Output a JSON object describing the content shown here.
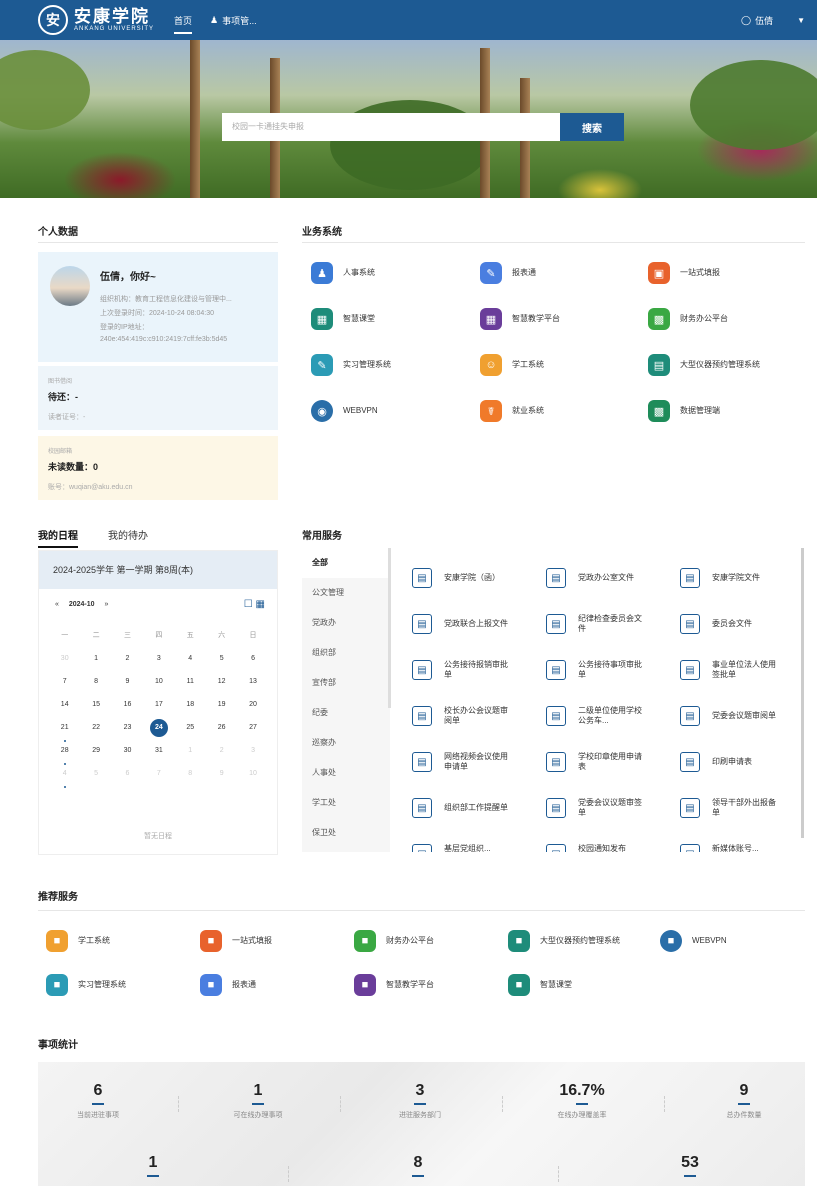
{
  "header": {
    "logo_seal": "安",
    "logo_cn": "安康学院",
    "logo_en": "ANKANG UNIVERSITY",
    "nav": [
      {
        "label": "首页",
        "icon": ""
      },
      {
        "label": "事项管...",
        "icon": "user-icon"
      }
    ],
    "user_name": "伍倩"
  },
  "banner": {
    "search_placeholder": "校园一卡通挂失申报",
    "search_button": "搜索"
  },
  "personal": {
    "title": "个人数据",
    "greeting": "伍倩，你好~",
    "org": "组织机构：教育工程信息化建设与管理中...",
    "last_login_time": "上次登录时间：2024-10-24 08:04:30",
    "last_login_ip_label": "登录的IP地址：",
    "last_login_ip": "240e:454:419c:c910:2419:7cff:fe3b:5d45",
    "library": {
      "tag": "图书借阅",
      "main": "待还：-",
      "sub": "读者证号：-"
    },
    "mail": {
      "tag": "校园邮箱",
      "main": "未读数量：0",
      "sub": "账号：wuqian@aku.edu.cn"
    }
  },
  "business": {
    "title": "业务系统",
    "items": [
      {
        "label": "人事系统",
        "icon": "person-icon",
        "color": "#3b7bd6"
      },
      {
        "label": "报表通",
        "icon": "form-icon",
        "color": "#4a7ee0"
      },
      {
        "label": "一站式填报",
        "icon": "monitor-icon",
        "color": "#e8622c"
      },
      {
        "label": "智慧课堂",
        "icon": "classroom-icon",
        "color": "#1e8c7a"
      },
      {
        "label": "智慧教学平台",
        "icon": "teaching-icon",
        "color": "#6a3d9a"
      },
      {
        "label": "财务办公平台",
        "icon": "finance-icon",
        "color": "#3aa843"
      },
      {
        "label": "实习管理系统",
        "icon": "intern-icon",
        "color": "#2b9bb5"
      },
      {
        "label": "学工系统",
        "icon": "student-icon",
        "color": "#f0a030"
      },
      {
        "label": "大型仪器预约管理系统",
        "icon": "instrument-icon",
        "color": "#1e8c7a"
      },
      {
        "label": "WEBVPN",
        "icon": "vpn-icon",
        "color": "#2a6ea8"
      },
      {
        "label": "就业系统",
        "icon": "job-icon",
        "color": "#f07a2a"
      },
      {
        "label": "数据管理端",
        "icon": "data-icon",
        "color": "#1e8c5a"
      }
    ]
  },
  "schedule": {
    "tabs": [
      "我的日程",
      "我的待办"
    ],
    "term": "2024-2025学年 第一学期 第8周(本)",
    "month": "2024-10",
    "prev": "«",
    "next": "»",
    "weekdays": [
      "一",
      "二",
      "三",
      "四",
      "五",
      "六",
      "日"
    ],
    "weeks": [
      [
        "30",
        "1",
        "2",
        "3",
        "4",
        "5",
        "6"
      ],
      [
        "7",
        "8",
        "9",
        "10",
        "11",
        "12",
        "13"
      ],
      [
        "14",
        "15",
        "16",
        "17",
        "18",
        "19",
        "20"
      ],
      [
        "21",
        "22",
        "23",
        "24",
        "25",
        "26",
        "27"
      ],
      [
        "28",
        "29",
        "30",
        "31",
        "1",
        "2",
        "3"
      ],
      [
        "4",
        "5",
        "6",
        "7",
        "8",
        "9",
        "10"
      ]
    ],
    "today": "24",
    "empty": "暂无日程"
  },
  "services": {
    "title": "常用服务",
    "categories": [
      "全部",
      "公文管理",
      "党政办",
      "组织部",
      "宣传部",
      "纪委",
      "巡察办",
      "人事处",
      "学工处",
      "保卫处"
    ],
    "items": [
      {
        "label": "安康学院（函）",
        "icon": "edit-doc-icon"
      },
      {
        "label": "党政办公室文件",
        "icon": "folder-icon"
      },
      {
        "label": "安康学院文件",
        "icon": "id-card-icon"
      },
      {
        "label": "党政联合上报文件",
        "icon": "upload-icon"
      },
      {
        "label": "纪律检查委员会文件",
        "icon": "seal-icon"
      },
      {
        "label": "委员会文件",
        "icon": "board-icon"
      },
      {
        "label": "公务接待报销审批单",
        "icon": "reception-icon"
      },
      {
        "label": "公务接待事项审批单",
        "icon": "building-icon"
      },
      {
        "label": "事业单位法人使用签批单",
        "icon": "house-icon"
      },
      {
        "label": "校长办公会议题审阅单",
        "icon": "meeting-icon"
      },
      {
        "label": "二级单位使用学校公务车...",
        "icon": "warning-icon"
      },
      {
        "label": "党委会议题审阅单",
        "icon": "chat-icon"
      },
      {
        "label": "网络视频会议使用申请单",
        "icon": "video-icon"
      },
      {
        "label": "学校印章使用申请表",
        "icon": "stamp-icon"
      },
      {
        "label": "印刷申请表",
        "icon": "print-icon"
      },
      {
        "label": "组织部工作提醒单",
        "icon": "notice-icon"
      },
      {
        "label": "党委会议议题审签单",
        "icon": "sign-icon"
      },
      {
        "label": "领导干部外出报备单",
        "icon": "report-icon"
      }
    ],
    "partial_row": [
      "基层党组织...",
      "校园通知发布",
      "新媒体账号..."
    ]
  },
  "recommended": {
    "title": "推荐服务",
    "items": [
      {
        "label": "学工系统",
        "color": "#f0a030"
      },
      {
        "label": "一站式填报",
        "color": "#e8622c"
      },
      {
        "label": "财务办公平台",
        "color": "#3aa843"
      },
      {
        "label": "大型仪器预约管理系统",
        "color": "#1e8c7a"
      },
      {
        "label": "WEBVPN",
        "color": "#2a6ea8"
      },
      {
        "label": "实习管理系统",
        "color": "#2b9bb5"
      },
      {
        "label": "报表通",
        "color": "#4a7ee0"
      },
      {
        "label": "智慧教学平台",
        "color": "#6a3d9a"
      },
      {
        "label": "智慧课堂",
        "color": "#1e8c7a"
      }
    ]
  },
  "stats": {
    "title": "事项统计",
    "items": [
      {
        "value": "6",
        "label": "当前进驻事项"
      },
      {
        "value": "1",
        "label": "可在线办理事项"
      },
      {
        "value": "3",
        "label": "进驻服务部门"
      },
      {
        "value": "16.7%",
        "label": "在线办理覆盖率"
      },
      {
        "value": "9",
        "label": "总办件数量"
      },
      {
        "value": "1",
        "label": ""
      },
      {
        "value": "8",
        "label": ""
      },
      {
        "value": "53",
        "label": ""
      }
    ]
  }
}
